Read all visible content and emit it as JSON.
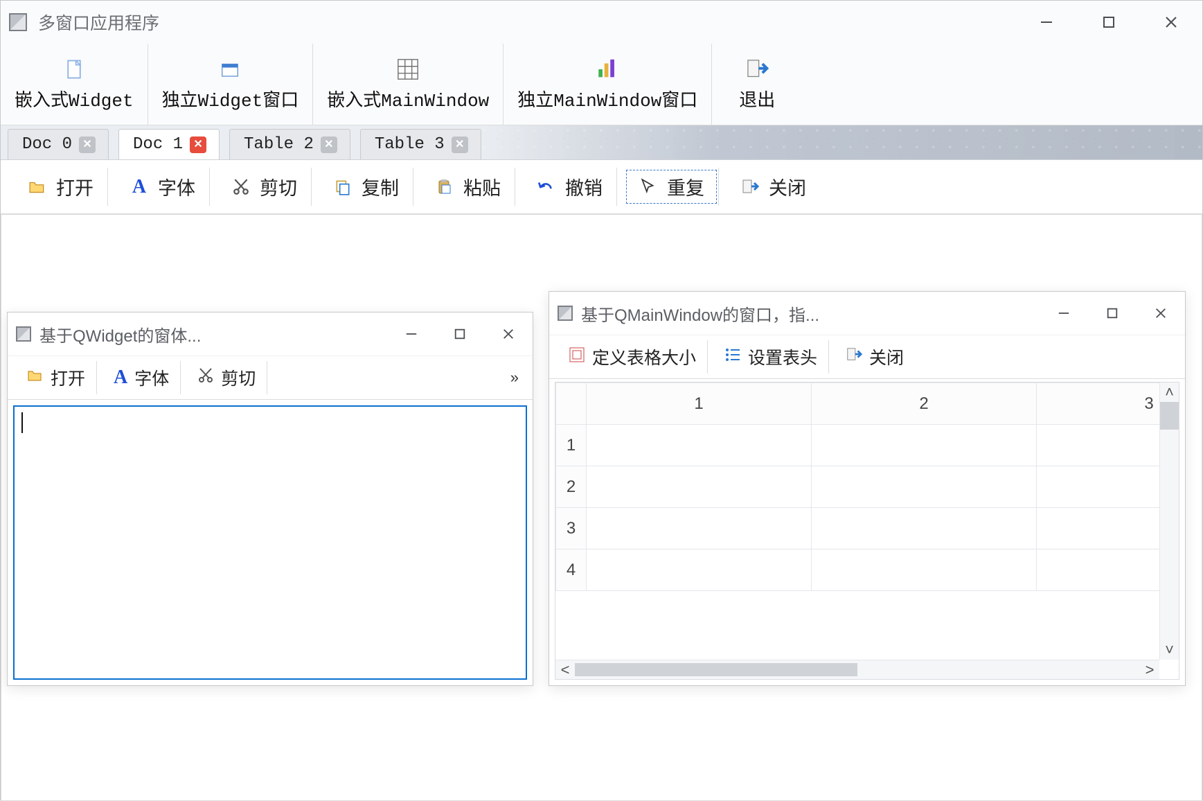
{
  "main": {
    "title": "多窗口应用程序",
    "toolbar": [
      {
        "icon": "file-icon",
        "label": "嵌入式Widget"
      },
      {
        "icon": "popup-icon",
        "label": "独立Widget窗口"
      },
      {
        "icon": "table-icon",
        "label": "嵌入式MainWindow"
      },
      {
        "icon": "chart-icon",
        "label": "独立MainWindow窗口"
      },
      {
        "icon": "exit-icon",
        "label": "退出"
      }
    ],
    "tabs": [
      {
        "label": "Doc 0",
        "active": false,
        "closeStyle": "gray"
      },
      {
        "label": "Doc 1",
        "active": true,
        "closeStyle": "red"
      },
      {
        "label": "Table 2",
        "active": false,
        "closeStyle": "gray"
      },
      {
        "label": "Table 3",
        "active": false,
        "closeStyle": "gray"
      }
    ],
    "docToolbar": {
      "open": "打开",
      "font": "字体",
      "cut": "剪切",
      "copy": "复制",
      "paste": "粘贴",
      "undo": "撤销",
      "redo": "重复",
      "close": "关闭"
    }
  },
  "widgetWindow": {
    "title": "基于QWidget的窗体...",
    "toolbar": {
      "open": "打开",
      "font": "字体",
      "cut": "剪切",
      "more": "»"
    },
    "textValue": ""
  },
  "tableWindow": {
    "title": "基于QMainWindow的窗口，指...",
    "toolbar": {
      "defineSize": "定义表格大小",
      "setHeader": "设置表头",
      "close": "关闭"
    },
    "columns": [
      "1",
      "2",
      "3"
    ],
    "rows": [
      "1",
      "2",
      "3",
      "4"
    ]
  }
}
